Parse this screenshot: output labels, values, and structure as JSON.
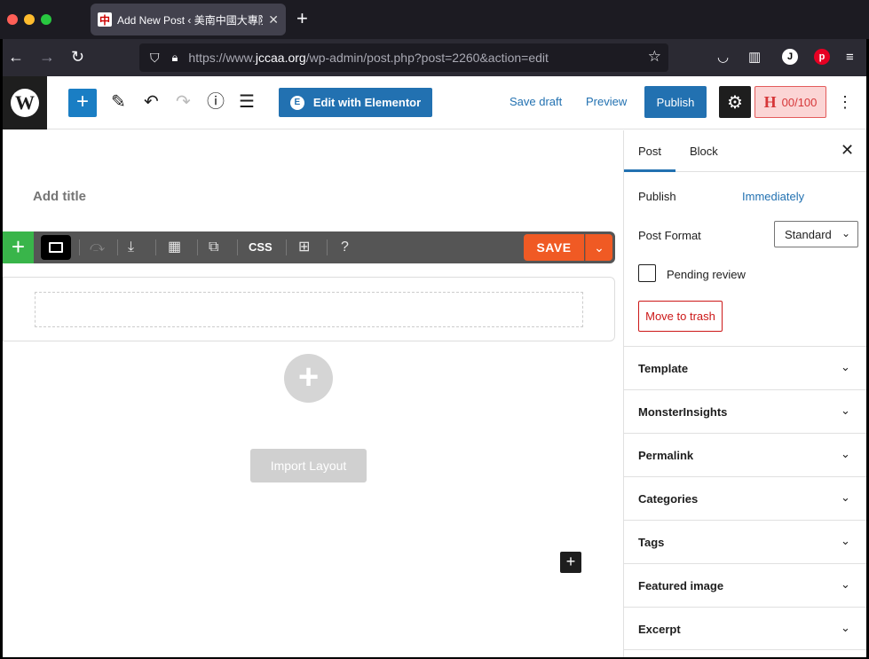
{
  "browser": {
    "tab_title": "Add New Post ‹ 美南中國大專院校",
    "tab_favicon": "中",
    "url_prefix": "https://www.",
    "url_domain": "jccaa.org",
    "url_path": "/wp-admin/post.php?post=2260&action=edit",
    "profile_initial": "J",
    "pinterest_initial": "p"
  },
  "toolbar": {
    "elementor_label": "Edit with Elementor",
    "elementor_icon": "E",
    "save_draft": "Save draft",
    "preview": "Preview",
    "publish": "Publish",
    "hscore_logo": "H",
    "hscore_value": "00/100"
  },
  "editor": {
    "title_placeholder": "Add title",
    "elementor_css": "CSS",
    "elementor_save": "SAVE",
    "import_layout": "Import Layout"
  },
  "sidebar": {
    "tabs": [
      {
        "label": "Post"
      },
      {
        "label": "Block"
      }
    ],
    "publish_label": "Publish",
    "publish_value": "Immediately",
    "post_format_label": "Post Format",
    "post_format_value": "Standard",
    "pending_review": "Pending review",
    "move_to_trash": "Move to trash",
    "panels": [
      {
        "label": "Template"
      },
      {
        "label": "MonsterInsights"
      },
      {
        "label": "Permalink"
      },
      {
        "label": "Categories"
      },
      {
        "label": "Tags"
      },
      {
        "label": "Featured image"
      },
      {
        "label": "Excerpt"
      }
    ]
  },
  "colors": {
    "wp_blue": "#2271b1",
    "elementor_green": "#39b54a",
    "elementor_save": "#f05a24",
    "trash_red": "#cc1818"
  }
}
